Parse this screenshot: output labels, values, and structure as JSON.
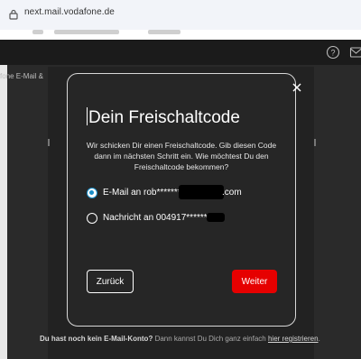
{
  "browser": {
    "url": "next.mail.vodafone.de"
  },
  "app_header": {
    "help_icon": "question-circle-icon",
    "mail_icon": "mail-icon"
  },
  "background": {
    "side_label": "fone E-Mail &",
    "footer_text_bold": "Du hast noch kein E-Mail-Konto?",
    "footer_text": " Dann kannst Du Dich ganz einfach ",
    "footer_link": "hier registrieren",
    "footer_end": "."
  },
  "modal": {
    "title": "Dein Freischaltcode",
    "description": "Wir schicken Dir einen Freischaltcode. Gib diesen Code dann im nächsten Schritt ein. Wie möchtest Du den Freischaltcode bekommen?",
    "options": [
      {
        "label_prefix": "E-Mail an rob*******",
        "label_suffix": ".com",
        "selected": true
      },
      {
        "label_prefix": "Nachricht an 004917******",
        "label_suffix": "",
        "selected": false
      }
    ],
    "back_label": "Zurück",
    "next_label": "Weiter",
    "accent_color": "#e60000",
    "radio_color": "#1a8ec8"
  }
}
